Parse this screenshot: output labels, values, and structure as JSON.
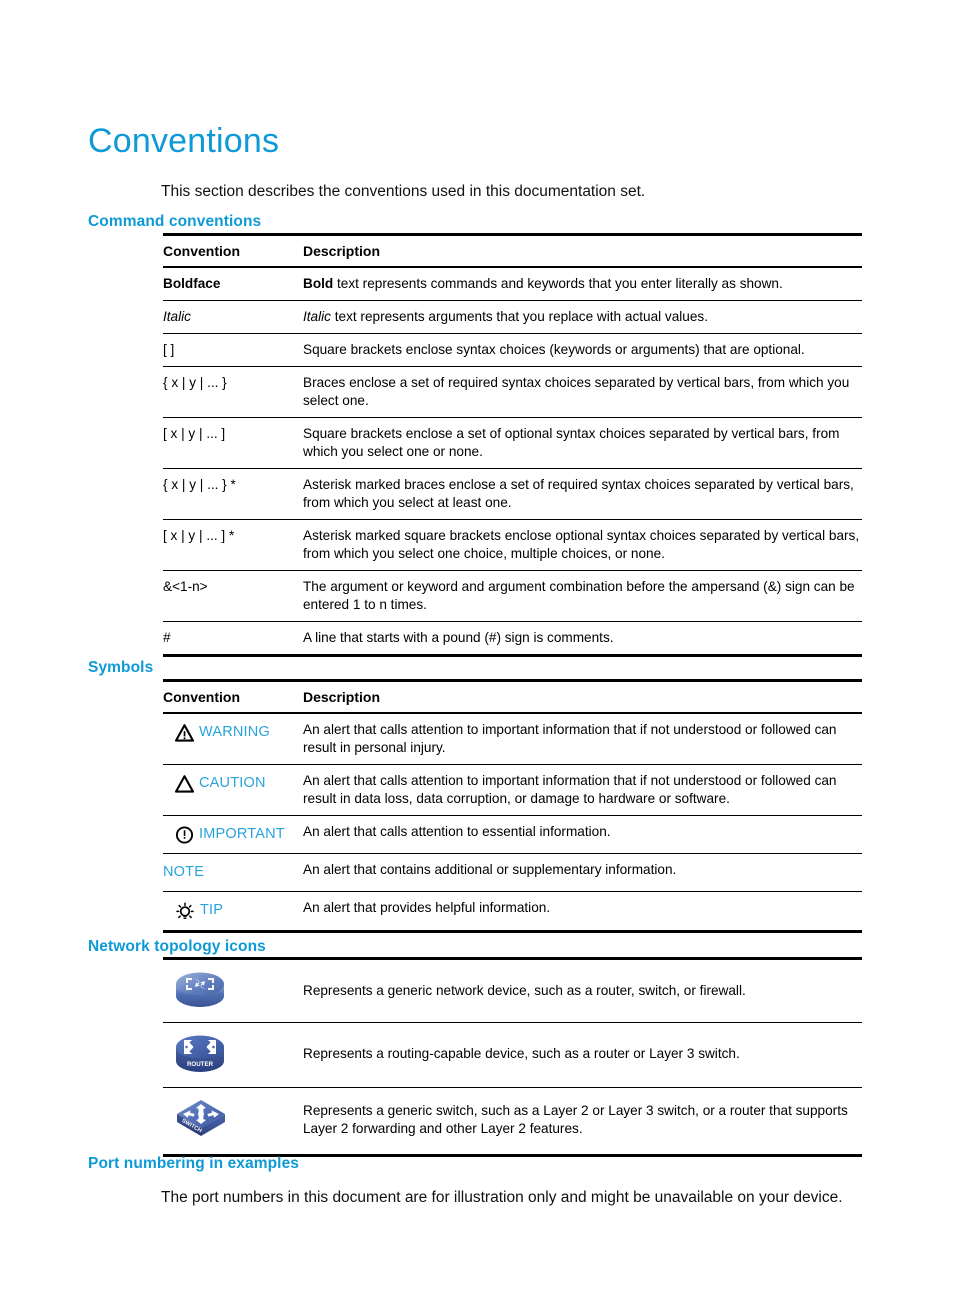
{
  "page": {
    "title": "Conventions",
    "intro": "This section describes the conventions used in this documentation set."
  },
  "sections": {
    "command": {
      "heading": "Command conventions"
    },
    "symbols": {
      "heading": "Symbols"
    },
    "topology": {
      "heading": "Network topology icons"
    },
    "port": {
      "heading": "Port numbering in examples",
      "body": "The port numbers in this document are for illustration only and might be unavailable on your device."
    }
  },
  "command_table": {
    "headers": {
      "convention": "Convention",
      "description": "Description"
    },
    "rows": [
      {
        "convention": "Boldface",
        "convention_style": "bold",
        "desc_lead": "Bold",
        "desc_lead_style": "bold",
        "desc_rest": " text represents commands and keywords that you enter literally as shown."
      },
      {
        "convention": "Italic",
        "convention_style": "italic",
        "desc_lead": "Italic",
        "desc_lead_style": "italic",
        "desc_rest": " text represents arguments that you replace with actual values."
      },
      {
        "convention": "[ ]",
        "convention_style": "normal",
        "desc_lead": "",
        "desc_lead_style": "normal",
        "desc_rest": "Square brackets enclose syntax choices (keywords or arguments) that are optional."
      },
      {
        "convention": "{ x | y | ... }",
        "convention_style": "normal",
        "desc_lead": "",
        "desc_lead_style": "normal",
        "desc_rest": "Braces enclose a set of required syntax choices separated by vertical bars, from which you select one."
      },
      {
        "convention": "[ x | y | ... ]",
        "convention_style": "normal",
        "desc_lead": "",
        "desc_lead_style": "normal",
        "desc_rest": "Square brackets enclose a set of optional syntax choices separated by vertical bars, from which you select one or none."
      },
      {
        "convention": "{ x | y | ... } *",
        "convention_style": "normal",
        "desc_lead": "",
        "desc_lead_style": "normal",
        "desc_rest": "Asterisk marked braces enclose a set of required syntax choices separated by vertical bars, from which you select at least one."
      },
      {
        "convention": "[ x | y | ... ] *",
        "convention_style": "normal",
        "desc_lead": "",
        "desc_lead_style": "normal",
        "desc_rest": "Asterisk marked square brackets enclose optional syntax choices separated by vertical bars, from which you select one choice, multiple choices, or none."
      },
      {
        "convention": "&<1-n>",
        "convention_style": "normal",
        "desc_lead": "",
        "desc_lead_style": "normal",
        "desc_rest": "The argument or keyword and argument combination before the ampersand (&) sign can be entered 1 to n times."
      },
      {
        "convention": "#",
        "convention_style": "normal",
        "desc_lead": "",
        "desc_lead_style": "normal",
        "desc_rest": "A line that starts with a pound (#) sign is comments."
      }
    ]
  },
  "symbols_table": {
    "headers": {
      "convention": "Convention",
      "description": "Description"
    },
    "rows": [
      {
        "icon": "warning-triangle-exclamation-icon",
        "label": "WARNING",
        "description": "An alert that calls attention to important information that if not understood or followed can result in personal injury."
      },
      {
        "icon": "caution-triangle-icon",
        "label": "CAUTION",
        "description": "An alert that calls attention to important information that if not understood or followed can result in data loss, data corruption, or damage to hardware or software."
      },
      {
        "icon": "important-circle-exclamation-icon",
        "label": "IMPORTANT",
        "description": "An alert that calls attention to essential information."
      },
      {
        "icon": "none",
        "label": "NOTE",
        "description": "An alert that contains additional or supplementary information."
      },
      {
        "icon": "tip-lightbulb-icon",
        "label": "TIP",
        "description": "An alert that provides helpful information."
      }
    ]
  },
  "topology_table": {
    "rows": [
      {
        "icon": "generic-network-device-icon",
        "icon_label": "",
        "description": "Represents a generic network device, such as a router, switch, or firewall."
      },
      {
        "icon": "router-icon",
        "icon_label": "ROUTER",
        "description": "Represents a routing-capable device, such as a router or Layer 3 switch."
      },
      {
        "icon": "switch-icon",
        "icon_label": "SWITCH",
        "description": "Represents a generic switch, such as a Layer 2 or Layer 3 switch, or a router that supports Layer 2 forwarding and other Layer 2 features."
      }
    ]
  },
  "colors": {
    "heading_blue": "#0e9ad6",
    "symbol_blue": "#29a3dc",
    "rule_black": "#000000",
    "icon_blue_dark": "#2b3f8c",
    "icon_blue_mid": "#4a6ab0",
    "icon_blue_light": "#7f9dd0"
  }
}
